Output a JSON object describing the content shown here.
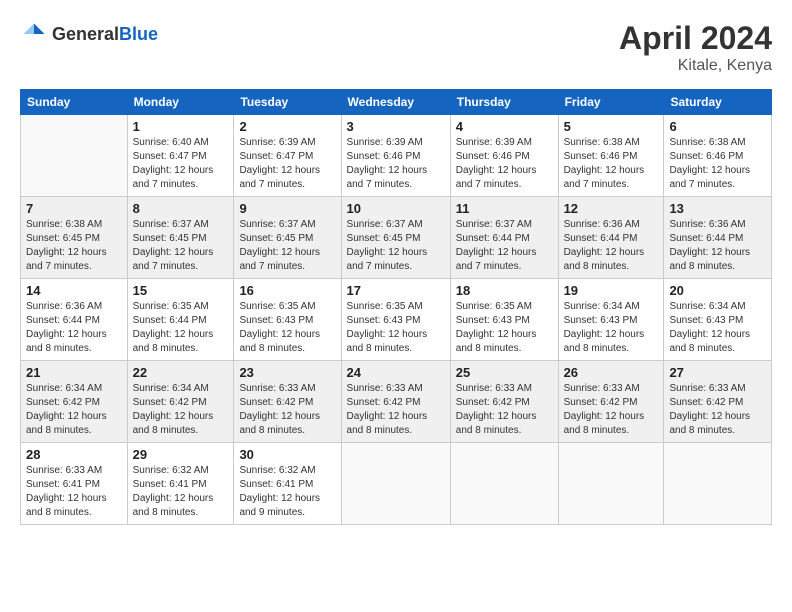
{
  "header": {
    "logo_general": "General",
    "logo_blue": "Blue",
    "month_title": "April 2024",
    "location": "Kitale, Kenya"
  },
  "days_of_week": [
    "Sunday",
    "Monday",
    "Tuesday",
    "Wednesday",
    "Thursday",
    "Friday",
    "Saturday"
  ],
  "weeks": [
    [
      {
        "day": "",
        "info": ""
      },
      {
        "day": "1",
        "info": "Sunrise: 6:40 AM\nSunset: 6:47 PM\nDaylight: 12 hours\nand 7 minutes."
      },
      {
        "day": "2",
        "info": "Sunrise: 6:39 AM\nSunset: 6:47 PM\nDaylight: 12 hours\nand 7 minutes."
      },
      {
        "day": "3",
        "info": "Sunrise: 6:39 AM\nSunset: 6:46 PM\nDaylight: 12 hours\nand 7 minutes."
      },
      {
        "day": "4",
        "info": "Sunrise: 6:39 AM\nSunset: 6:46 PM\nDaylight: 12 hours\nand 7 minutes."
      },
      {
        "day": "5",
        "info": "Sunrise: 6:38 AM\nSunset: 6:46 PM\nDaylight: 12 hours\nand 7 minutes."
      },
      {
        "day": "6",
        "info": "Sunrise: 6:38 AM\nSunset: 6:46 PM\nDaylight: 12 hours\nand 7 minutes."
      }
    ],
    [
      {
        "day": "7",
        "info": "Sunrise: 6:38 AM\nSunset: 6:45 PM\nDaylight: 12 hours\nand 7 minutes."
      },
      {
        "day": "8",
        "info": "Sunrise: 6:37 AM\nSunset: 6:45 PM\nDaylight: 12 hours\nand 7 minutes."
      },
      {
        "day": "9",
        "info": "Sunrise: 6:37 AM\nSunset: 6:45 PM\nDaylight: 12 hours\nand 7 minutes."
      },
      {
        "day": "10",
        "info": "Sunrise: 6:37 AM\nSunset: 6:45 PM\nDaylight: 12 hours\nand 7 minutes."
      },
      {
        "day": "11",
        "info": "Sunrise: 6:37 AM\nSunset: 6:44 PM\nDaylight: 12 hours\nand 7 minutes."
      },
      {
        "day": "12",
        "info": "Sunrise: 6:36 AM\nSunset: 6:44 PM\nDaylight: 12 hours\nand 8 minutes."
      },
      {
        "day": "13",
        "info": "Sunrise: 6:36 AM\nSunset: 6:44 PM\nDaylight: 12 hours\nand 8 minutes."
      }
    ],
    [
      {
        "day": "14",
        "info": "Sunrise: 6:36 AM\nSunset: 6:44 PM\nDaylight: 12 hours\nand 8 minutes."
      },
      {
        "day": "15",
        "info": "Sunrise: 6:35 AM\nSunset: 6:44 PM\nDaylight: 12 hours\nand 8 minutes."
      },
      {
        "day": "16",
        "info": "Sunrise: 6:35 AM\nSunset: 6:43 PM\nDaylight: 12 hours\nand 8 minutes."
      },
      {
        "day": "17",
        "info": "Sunrise: 6:35 AM\nSunset: 6:43 PM\nDaylight: 12 hours\nand 8 minutes."
      },
      {
        "day": "18",
        "info": "Sunrise: 6:35 AM\nSunset: 6:43 PM\nDaylight: 12 hours\nand 8 minutes."
      },
      {
        "day": "19",
        "info": "Sunrise: 6:34 AM\nSunset: 6:43 PM\nDaylight: 12 hours\nand 8 minutes."
      },
      {
        "day": "20",
        "info": "Sunrise: 6:34 AM\nSunset: 6:43 PM\nDaylight: 12 hours\nand 8 minutes."
      }
    ],
    [
      {
        "day": "21",
        "info": "Sunrise: 6:34 AM\nSunset: 6:42 PM\nDaylight: 12 hours\nand 8 minutes."
      },
      {
        "day": "22",
        "info": "Sunrise: 6:34 AM\nSunset: 6:42 PM\nDaylight: 12 hours\nand 8 minutes."
      },
      {
        "day": "23",
        "info": "Sunrise: 6:33 AM\nSunset: 6:42 PM\nDaylight: 12 hours\nand 8 minutes."
      },
      {
        "day": "24",
        "info": "Sunrise: 6:33 AM\nSunset: 6:42 PM\nDaylight: 12 hours\nand 8 minutes."
      },
      {
        "day": "25",
        "info": "Sunrise: 6:33 AM\nSunset: 6:42 PM\nDaylight: 12 hours\nand 8 minutes."
      },
      {
        "day": "26",
        "info": "Sunrise: 6:33 AM\nSunset: 6:42 PM\nDaylight: 12 hours\nand 8 minutes."
      },
      {
        "day": "27",
        "info": "Sunrise: 6:33 AM\nSunset: 6:42 PM\nDaylight: 12 hours\nand 8 minutes."
      }
    ],
    [
      {
        "day": "28",
        "info": "Sunrise: 6:33 AM\nSunset: 6:41 PM\nDaylight: 12 hours\nand 8 minutes."
      },
      {
        "day": "29",
        "info": "Sunrise: 6:32 AM\nSunset: 6:41 PM\nDaylight: 12 hours\nand 8 minutes."
      },
      {
        "day": "30",
        "info": "Sunrise: 6:32 AM\nSunset: 6:41 PM\nDaylight: 12 hours\nand 9 minutes."
      },
      {
        "day": "",
        "info": ""
      },
      {
        "day": "",
        "info": ""
      },
      {
        "day": "",
        "info": ""
      },
      {
        "day": "",
        "info": ""
      }
    ]
  ]
}
